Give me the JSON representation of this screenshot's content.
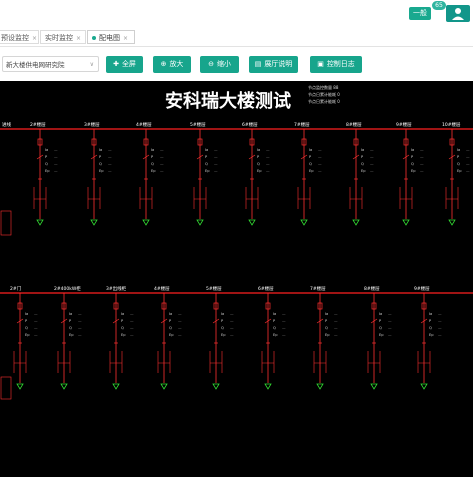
{
  "header": {
    "level_label": "一般",
    "badge_count": "65"
  },
  "tabs": [
    {
      "label": "预设监控",
      "closable": true,
      "active": false
    },
    {
      "label": "实时监控",
      "closable": true,
      "active": false
    },
    {
      "label": "配电图",
      "closable": true,
      "active": true
    }
  ],
  "toolbar": {
    "site_select": "新大楼供电网研究院",
    "fullscreen": "全屏",
    "zoom_in": "放大",
    "zoom_out": "缩小",
    "screen_desc": "展厅说明",
    "control_log": "控制日志"
  },
  "diagram": {
    "title": "安科瑞大楼测试",
    "info_lines": [
      "节点监控数量 88",
      "节点日累计能耗 0",
      "节点日累计能耗 0"
    ],
    "top_left_label": "进线",
    "top_row_labels": [
      "2#楼层",
      "3#楼层",
      "4#楼层",
      "5#楼层",
      "6#楼层",
      "7#楼层",
      "8#楼层",
      "9#楼层",
      "10#楼层"
    ],
    "bottom_row_labels": [
      "2#门",
      "2#400kW柜",
      "3#出线柜",
      "4#楼层",
      "5#楼层",
      "6#楼层",
      "7#楼层",
      "8#楼层",
      "9#楼层"
    ],
    "meter_labels": [
      "Ia",
      "P",
      "Q",
      "Ep"
    ],
    "bus_color": "#ff2020",
    "breaker_color": "#ff3030",
    "ground_color": "#33dd33",
    "text_color": "#ffffff"
  }
}
